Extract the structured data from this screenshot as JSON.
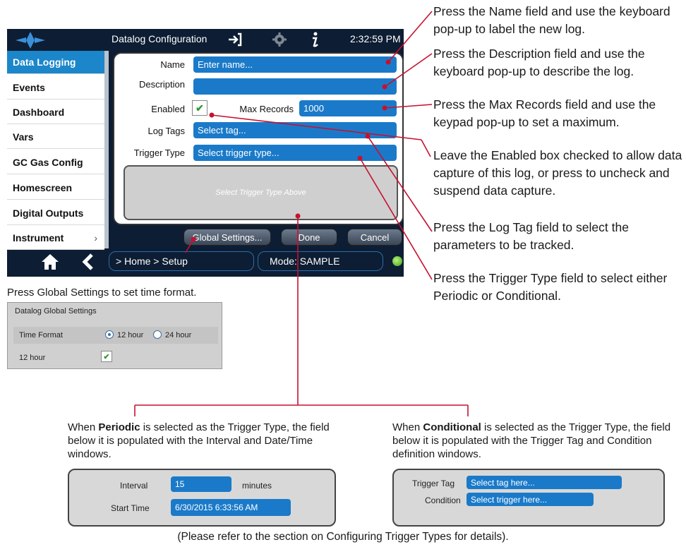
{
  "screen": {
    "title": "Datalog Configuration",
    "time": "2:32:59 PM",
    "sidebar": {
      "items": [
        {
          "label": "Data Logging"
        },
        {
          "label": "Events"
        },
        {
          "label": "Dashboard"
        },
        {
          "label": "Vars"
        },
        {
          "label": "GC Gas Config"
        },
        {
          "label": "Homescreen"
        },
        {
          "label": "Digital Outputs"
        },
        {
          "label": "Instrument"
        }
      ]
    },
    "form": {
      "name_label": "Name",
      "name_placeholder": "Enter name...",
      "description_label": "Description",
      "description_value": "",
      "enabled_label": "Enabled",
      "max_records_label": "Max Records",
      "max_records_value": "1000",
      "log_tags_label": "Log Tags",
      "log_tags_placeholder": "Select tag...",
      "trigger_type_label": "Trigger Type",
      "trigger_type_placeholder": "Select trigger type...",
      "trigger_area_text": "Select Trigger Type Above"
    },
    "buttons": {
      "global_settings": "Global Settings...",
      "done": "Done",
      "cancel": "Cancel"
    },
    "status": {
      "breadcrumb": "> Home > Setup",
      "mode": "Mode: SAMPLE"
    }
  },
  "callouts": {
    "name": "Press the Name field and use the keyboard pop-up to label the new log.",
    "description": "Press the Description field and use the keyboard pop-up to describe the log.",
    "max_records": "Press the Max Records field and use the keypad pop-up to set a maximum.",
    "enabled": "Leave the Enabled box checked to allow data capture of this log, or press to uncheck and suspend data capture.",
    "log_tag": "Press the Log Tag field to select the parameters to be tracked.",
    "trigger_type": "Press the Trigger Type field to select either Periodic or Conditional."
  },
  "global_settings_note": "Press Global Settings to set time format.",
  "global_dialog": {
    "title": "Datalog Global Settings",
    "time_format_label": "Time Format",
    "option_12": "12 hour",
    "option_24": "24 hour",
    "row2_label": "12 hour"
  },
  "periodic": {
    "pre": "When ",
    "bold": "Periodic",
    "post": " is selected as the Trigger Type, the field below it is populated with the Interval and Date/Time windows.",
    "interval_label": "Interval",
    "interval_value": "15",
    "interval_unit": "minutes",
    "start_time_label": "Start Time",
    "start_time_value": "6/30/2015 6:33:56 AM"
  },
  "conditional": {
    "pre": "When ",
    "bold": "Conditional",
    "post": " is selected as the Trigger Type, the field below it is populated with the Trigger Tag and Condition definition windows.",
    "trigger_tag_label": "Trigger Tag",
    "trigger_tag_placeholder": "Select tag here...",
    "condition_label": "Condition",
    "condition_placeholder": "Select trigger here..."
  },
  "footer": "(Please refer to the section on Configuring Trigger Types for details).",
  "colors": {
    "accent": "#1a7ac9",
    "nav_dark": "#0d1d33",
    "callout_line": "#c8102e",
    "check_green": "#2e9b2e"
  }
}
